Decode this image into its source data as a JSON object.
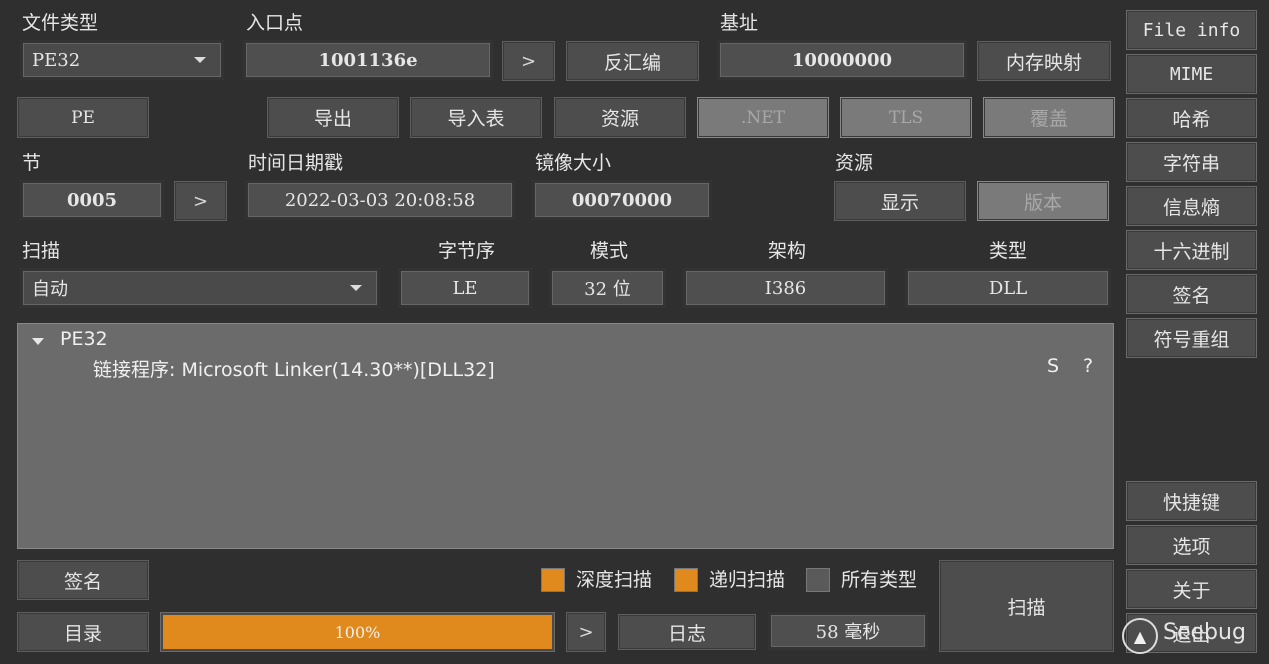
{
  "labels": {
    "file_type": "文件类型",
    "entry_point": "入口点",
    "base_address": "基址",
    "section": "节",
    "timestamp": "时间日期戳",
    "image_size": "镜像大小",
    "resources": "资源",
    "scan": "扫描",
    "byte_order": "字节序",
    "mode": "模式",
    "architecture": "架构",
    "type": "类型"
  },
  "values": {
    "file_type": "PE32",
    "entry_point": "1001136e",
    "base_address": "10000000",
    "section": "0005",
    "timestamp": "2022-03-03 20:08:58",
    "image_size": "00070000",
    "scan": "自动",
    "byte_order": "LE",
    "mode": "32 位",
    "architecture": "I386",
    "type": "DLL"
  },
  "buttons": {
    "disasm": "反汇编",
    "memory_map": "内存映射",
    "pe": "PE",
    "export": "导出",
    "import": "导入表",
    "resources": "资源",
    "dotnet": ".NET",
    "tls": "TLS",
    "overlay": "覆盖",
    "show": "显示",
    "version": "版本",
    "signature": "签名",
    "directory": "目录",
    "log": "日志",
    "scan": "扫描",
    "chevron": ">"
  },
  "sidebar": [
    "File info",
    "MIME",
    "哈希",
    "字符串",
    "信息熵",
    "十六进制",
    "签名",
    "符号重组"
  ],
  "sidebar_bottom": [
    "快捷键",
    "选项",
    "关于",
    "退出"
  ],
  "result": {
    "root": "PE32",
    "line": "链接程序: Microsoft Linker(14.30**)[DLL32]",
    "s": "S",
    "q": "?"
  },
  "checks": {
    "deep_scan": "深度扫描",
    "recursive_scan": "递归扫描",
    "all_types": "所有类型"
  },
  "progress": {
    "value": 1.0,
    "label": "100%"
  },
  "elapsed": "58 毫秒",
  "watermark": "Seebug",
  "colors": {
    "accent": "#e08a1e",
    "background": "#2f2f2f",
    "button": "#4d4d4d",
    "result_bg": "#6b6b6b"
  }
}
